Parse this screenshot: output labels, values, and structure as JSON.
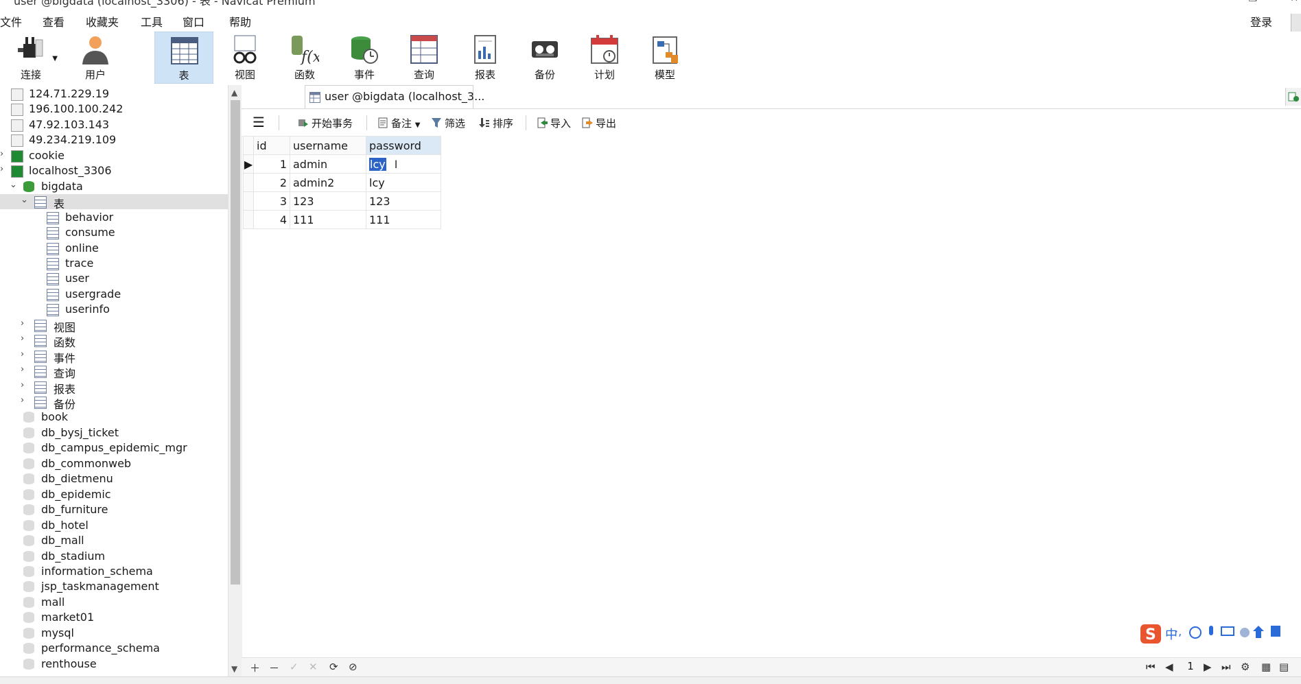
{
  "window": {
    "title": "user @bigdata (localhost_3306) - 表 - Navicat Premium"
  },
  "menubar": {
    "items": [
      "文件",
      "查看",
      "收藏夹",
      "工具",
      "窗口",
      "帮助"
    ],
    "login": "登录"
  },
  "ribbon": {
    "buttons": [
      {
        "label": "连接",
        "icon": "plug-icon"
      },
      {
        "label": "用户",
        "icon": "user-icon"
      },
      {
        "label": "表",
        "icon": "table-icon",
        "active": true
      },
      {
        "label": "视图",
        "icon": "view-glasses-icon"
      },
      {
        "label": "函数",
        "icon": "function-icon"
      },
      {
        "label": "事件",
        "icon": "event-clock-icon"
      },
      {
        "label": "查询",
        "icon": "query-icon"
      },
      {
        "label": "报表",
        "icon": "report-icon"
      },
      {
        "label": "备份",
        "icon": "backup-icon"
      },
      {
        "label": "计划",
        "icon": "calendar-icon"
      },
      {
        "label": "模型",
        "icon": "model-icon"
      }
    ]
  },
  "sidebar": {
    "items": [
      {
        "label": "124.71.229.19",
        "type": "connection"
      },
      {
        "label": "196.100.100.242",
        "type": "connection"
      },
      {
        "label": "47.92.103.143",
        "type": "connection"
      },
      {
        "label": "49.234.219.109",
        "type": "connection"
      },
      {
        "label": "cookie",
        "type": "connection-open"
      },
      {
        "label": "localhost_3306",
        "type": "connection-open"
      },
      {
        "label": "bigdata",
        "type": "database-open"
      },
      {
        "label": "表",
        "type": "table-group"
      },
      {
        "label": "behavior",
        "type": "table"
      },
      {
        "label": "consume",
        "type": "table"
      },
      {
        "label": "online",
        "type": "table"
      },
      {
        "label": "trace",
        "type": "table"
      },
      {
        "label": "user",
        "type": "table"
      },
      {
        "label": "usergrade",
        "type": "table"
      },
      {
        "label": "userinfo",
        "type": "table"
      },
      {
        "label": "视图",
        "type": "group"
      },
      {
        "label": "函数",
        "type": "group"
      },
      {
        "label": "事件",
        "type": "group"
      },
      {
        "label": "查询",
        "type": "group"
      },
      {
        "label": "报表",
        "type": "group"
      },
      {
        "label": "备份",
        "type": "group"
      },
      {
        "label": "book",
        "type": "database"
      },
      {
        "label": "db_bysj_ticket",
        "type": "database"
      },
      {
        "label": "db_campus_epidemic_mgr",
        "type": "database"
      },
      {
        "label": "db_commonweb",
        "type": "database"
      },
      {
        "label": "db_dietmenu",
        "type": "database"
      },
      {
        "label": "db_epidemic",
        "type": "database"
      },
      {
        "label": "db_furniture",
        "type": "database"
      },
      {
        "label": "db_hotel",
        "type": "database"
      },
      {
        "label": "db_mall",
        "type": "database"
      },
      {
        "label": "db_stadium",
        "type": "database"
      },
      {
        "label": "information_schema",
        "type": "database"
      },
      {
        "label": "jsp_taskmanagement",
        "type": "database"
      },
      {
        "label": "mall",
        "type": "database"
      },
      {
        "label": "market01",
        "type": "database"
      },
      {
        "label": "mysql",
        "type": "database"
      },
      {
        "label": "performance_schema",
        "type": "database"
      },
      {
        "label": "renthouse",
        "type": "database"
      }
    ]
  },
  "tab": {
    "label": "user @bigdata (localhost_3..."
  },
  "toolbar": {
    "menu_icon": "hamburger-icon",
    "begin_transaction": "开始事务",
    "memo": "备注",
    "filter": "筛选",
    "sort": "排序",
    "import": "导入",
    "export": "导出"
  },
  "grid": {
    "columns": [
      "id",
      "username",
      "password"
    ],
    "rows": [
      {
        "id": "1",
        "username": "admin",
        "password": "lcy"
      },
      {
        "id": "2",
        "username": "admin2",
        "password": "lcy"
      },
      {
        "id": "3",
        "username": "123",
        "password": "123"
      },
      {
        "id": "4",
        "username": "111",
        "password": "111"
      }
    ]
  },
  "pagination": {
    "page": "1"
  },
  "ime": {
    "label": "中"
  },
  "colors": {
    "accent": "#2b63c6",
    "ribbon_active": "#cfe3f6",
    "selected_tree_row": "#e0e0e0"
  }
}
